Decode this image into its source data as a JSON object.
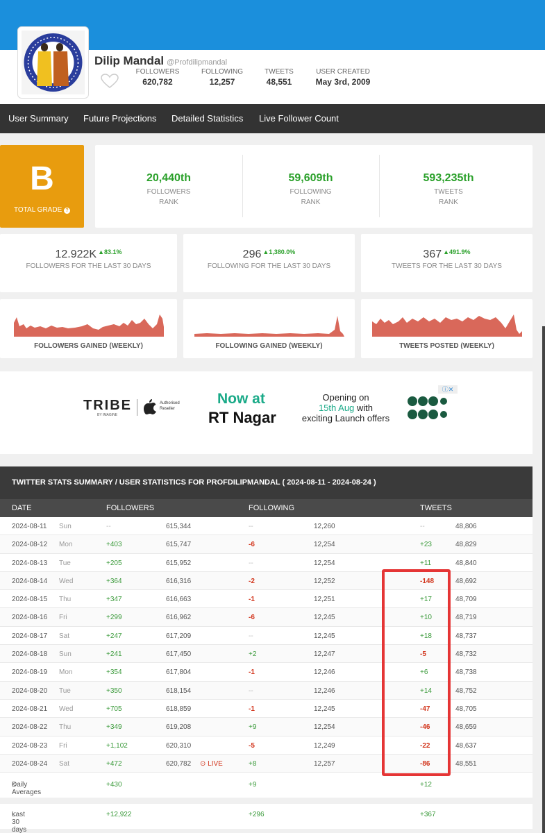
{
  "profile": {
    "name": "Dilip Mandal",
    "handle": "@Profdilipmandal",
    "stats": [
      {
        "label": "FOLLOWERS",
        "value": "620,782"
      },
      {
        "label": "FOLLOWING",
        "value": "12,257"
      },
      {
        "label": "TWEETS",
        "value": "48,551"
      },
      {
        "label": "USER CREATED",
        "value": "May 3rd, 2009"
      }
    ]
  },
  "nav": [
    "User Summary",
    "Future Projections",
    "Detailed Statistics",
    "Live Follower Count"
  ],
  "grade": {
    "letter": "B",
    "label": "TOTAL GRADE"
  },
  "ranks": [
    {
      "value": "20,440th",
      "label1": "FOLLOWERS",
      "label2": "RANK"
    },
    {
      "value": "59,609th",
      "label1": "FOLLOWING",
      "label2": "RANK"
    },
    {
      "value": "593,235th",
      "label1": "TWEETS",
      "label2": "RANK"
    }
  ],
  "totals": [
    {
      "value": "12.922K",
      "pct": "▲83.1%",
      "label": "FOLLOWERS FOR THE LAST 30 DAYS"
    },
    {
      "value": "296",
      "pct": "▲1,380.0%",
      "label": "FOLLOWING FOR THE LAST 30 DAYS"
    },
    {
      "value": "367",
      "pct": "▲491.9%",
      "label": "TWEETS FOR THE LAST 30 DAYS"
    }
  ],
  "sparks": [
    {
      "label": "FOLLOWERS GAINED (WEEKLY)"
    },
    {
      "label": "FOLLOWING GAINED (WEEKLY)"
    },
    {
      "label": "TWEETS POSTED (WEEKLY)"
    }
  ],
  "ad": {
    "brand": "TRIBE",
    "brand_sub": "BY IMAGINE",
    "reseller1": "Authorised",
    "reseller2": "Reseller",
    "headline1": "Now at",
    "headline2": "RT Nagar",
    "opening1": "Opening on",
    "opening2": "15th Aug",
    "opening3": "with",
    "opening4": "exciting Launch offers"
  },
  "table": {
    "title": "TWITTER STATS SUMMARY / USER STATISTICS FOR PROFDILIPMANDAL ( 2024-08-11 - 2024-08-24 )",
    "columns": [
      "DATE",
      "FOLLOWERS",
      "FOLLOWING",
      "TWEETS"
    ],
    "live_label": "LIVE",
    "rows": [
      {
        "date": "2024-08-11",
        "day": "Sun",
        "f_d": "--",
        "f": "615,344",
        "g_d": "--",
        "g": "12,260",
        "t_d": "--",
        "t": "48,806"
      },
      {
        "date": "2024-08-12",
        "day": "Mon",
        "f_d": "+403",
        "f": "615,747",
        "g_d": "-6",
        "g": "12,254",
        "t_d": "+23",
        "t": "48,829"
      },
      {
        "date": "2024-08-13",
        "day": "Tue",
        "f_d": "+205",
        "f": "615,952",
        "g_d": "--",
        "g": "12,254",
        "t_d": "+11",
        "t": "48,840"
      },
      {
        "date": "2024-08-14",
        "day": "Wed",
        "f_d": "+364",
        "f": "616,316",
        "g_d": "-2",
        "g": "12,252",
        "t_d": "-148",
        "t": "48,692"
      },
      {
        "date": "2024-08-15",
        "day": "Thu",
        "f_d": "+347",
        "f": "616,663",
        "g_d": "-1",
        "g": "12,251",
        "t_d": "+17",
        "t": "48,709"
      },
      {
        "date": "2024-08-16",
        "day": "Fri",
        "f_d": "+299",
        "f": "616,962",
        "g_d": "-6",
        "g": "12,245",
        "t_d": "+10",
        "t": "48,719"
      },
      {
        "date": "2024-08-17",
        "day": "Sat",
        "f_d": "+247",
        "f": "617,209",
        "g_d": "--",
        "g": "12,245",
        "t_d": "+18",
        "t": "48,737"
      },
      {
        "date": "2024-08-18",
        "day": "Sun",
        "f_d": "+241",
        "f": "617,450",
        "g_d": "+2",
        "g": "12,247",
        "t_d": "-5",
        "t": "48,732"
      },
      {
        "date": "2024-08-19",
        "day": "Mon",
        "f_d": "+354",
        "f": "617,804",
        "g_d": "-1",
        "g": "12,246",
        "t_d": "+6",
        "t": "48,738"
      },
      {
        "date": "2024-08-20",
        "day": "Tue",
        "f_d": "+350",
        "f": "618,154",
        "g_d": "--",
        "g": "12,246",
        "t_d": "+14",
        "t": "48,752"
      },
      {
        "date": "2024-08-21",
        "day": "Wed",
        "f_d": "+705",
        "f": "618,859",
        "g_d": "-1",
        "g": "12,245",
        "t_d": "-47",
        "t": "48,705"
      },
      {
        "date": "2024-08-22",
        "day": "Thu",
        "f_d": "+349",
        "f": "619,208",
        "g_d": "+9",
        "g": "12,254",
        "t_d": "-46",
        "t": "48,659"
      },
      {
        "date": "2024-08-23",
        "day": "Fri",
        "f_d": "+1,102",
        "f": "620,310",
        "g_d": "-5",
        "g": "12,249",
        "t_d": "-22",
        "t": "48,637"
      },
      {
        "date": "2024-08-24",
        "day": "Sat",
        "f_d": "+472",
        "f": "620,782",
        "g_d": "+8",
        "g": "12,257",
        "t_d": "-86",
        "t": "48,551",
        "live": true
      }
    ],
    "daily": {
      "label": "Daily Averages",
      "f": "+430",
      "g": "+9",
      "t": "+12"
    },
    "last30": {
      "label": "Last 30 days",
      "f": "+12,922",
      "g": "+296",
      "t": "+367"
    }
  },
  "colors": {
    "accent_blue": "#1b8fdc",
    "grade_orange": "#e89c0e",
    "positive": "#3a9a3a",
    "negative": "#d2351c",
    "highlight": "#e53535"
  }
}
